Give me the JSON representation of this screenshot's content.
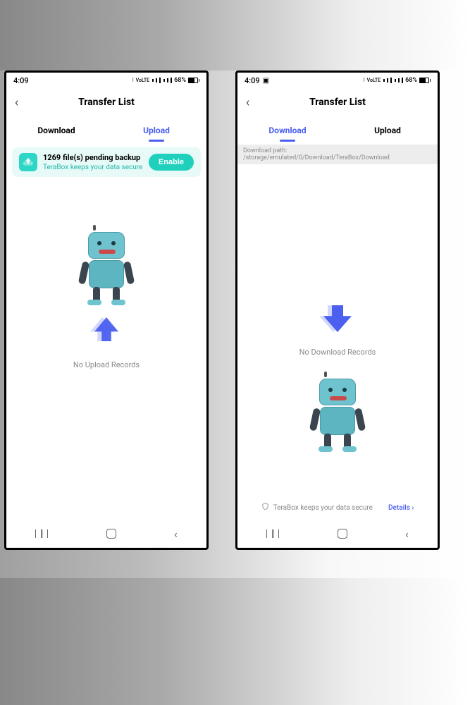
{
  "left": {
    "status": {
      "time": "4:09",
      "battery": "68%"
    },
    "header": {
      "title": "Transfer List"
    },
    "tabs": {
      "download": "Download",
      "upload": "Upload",
      "active": "upload"
    },
    "banner": {
      "title": "1269 file(s) pending backup",
      "subtitle": "TeraBox keeps your data secure",
      "button": "Enable"
    },
    "empty": "No Upload Records"
  },
  "right": {
    "status": {
      "time": "4:09",
      "battery": "68%"
    },
    "header": {
      "title": "Transfer List"
    },
    "tabs": {
      "download": "Download",
      "upload": "Upload",
      "active": "download"
    },
    "path": "Download path: /storage/emulated/0/Download/TeraBox/Download",
    "empty": "No Download Records",
    "footer": {
      "secure": "TeraBox keeps your data secure",
      "details": "Details"
    }
  }
}
